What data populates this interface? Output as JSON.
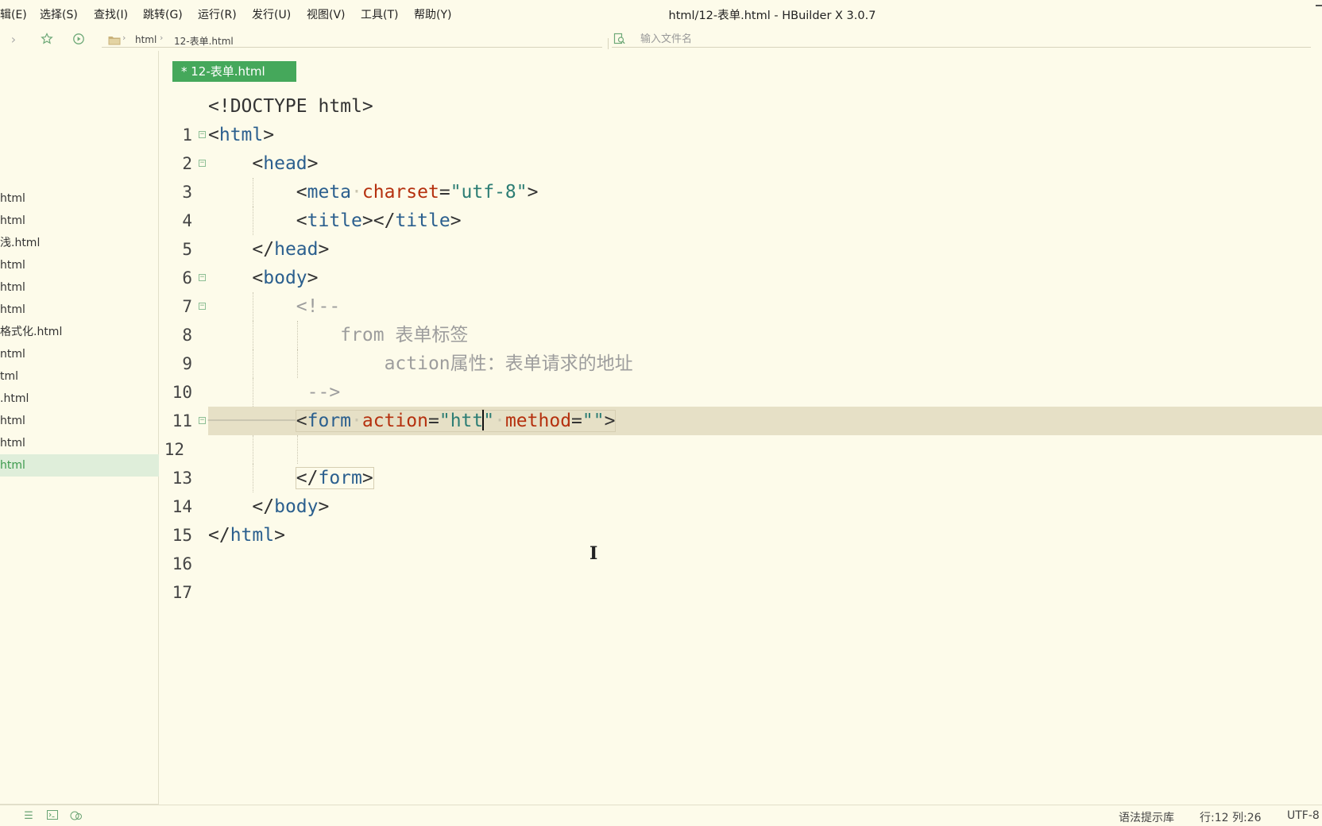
{
  "window": {
    "title": "html/12-表单.html - HBuilder X 3.0.7"
  },
  "menu": [
    "辑(E)",
    "选择(S)",
    "查找(I)",
    "跳转(G)",
    "运行(R)",
    "发行(U)",
    "视图(V)",
    "工具(T)",
    "帮助(Y)"
  ],
  "toolbar": {
    "breadcrumb": [
      "html",
      "12-表单.html"
    ],
    "file_search_placeholder": "输入文件名"
  },
  "sidebar": {
    "files": [
      "html",
      "html",
      "浅.html",
      "html",
      "html",
      "html",
      "格式化.html",
      "ntml",
      "tml",
      ".html",
      "html",
      "html",
      "html"
    ],
    "active_index": 12
  },
  "editor": {
    "tab_label": "* 12-表单.html",
    "current_line": 12,
    "line_numbers": [
      "1",
      "2",
      "3",
      "4",
      "5",
      "6",
      "7",
      "8",
      "9",
      "10",
      "11",
      "12",
      "13",
      "14",
      "15",
      "16",
      "17"
    ],
    "tokens": {
      "doctype": "<!DOCTYPE html>",
      "html": "html",
      "head": "head",
      "meta": "meta",
      "charset_attr": "charset",
      "charset_val": "\"utf-8\"",
      "title": "title",
      "body": "body",
      "comment_open": "<!--",
      "comment_line1": "from 表单标签",
      "comment_line2": "action属性：表单请求的地址",
      "comment_close": "-->",
      "form": "form",
      "action_attr": "action",
      "action_val_before_caret": "\"htt",
      "action_val_after_caret": "\"",
      "method_attr": "method",
      "method_val": "\"\""
    }
  },
  "status": {
    "syntax": "语法提示库",
    "position": "行:12  列:26",
    "encoding": "UTF-8"
  },
  "colors": {
    "background": "#fdfbea",
    "tab_active": "#45a85b",
    "current_line": "#e6e0c6",
    "sidebar_active": "#dfeeda",
    "tag": "#2b5f8e",
    "attribute": "#b5300e",
    "string": "#2c7d74",
    "comment": "#9d9d9d"
  }
}
